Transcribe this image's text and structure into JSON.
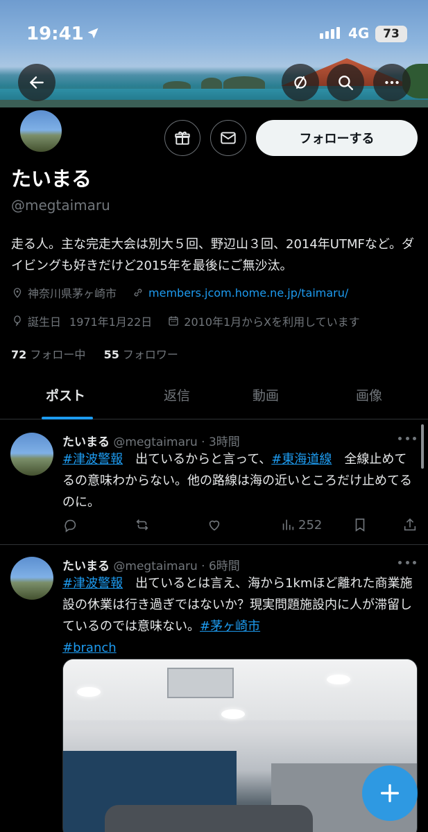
{
  "status_bar": {
    "time": "19:41",
    "network": "4G",
    "battery": "73"
  },
  "profile": {
    "display_name": "たいまる",
    "handle": "@megtaimaru",
    "follow_label": "フォローする",
    "bio": "走る人。主な完走大会は別大５回、野辺山３回、2014年UTMFなど。ダイビングも好きだけど2015年を最後にご無沙汰。",
    "location": "神奈川県茅ヶ崎市",
    "website": "members.jcom.home.ne.jp/taimaru/",
    "birthday_label": "誕生日",
    "birthday": "1971年1月22日",
    "joined": "2010年1月からXを利用しています",
    "following_count": "72",
    "following_label": "フォロー中",
    "followers_count": "55",
    "followers_label": "フォロワー"
  },
  "tabs": [
    "ポスト",
    "返信",
    "動画",
    "画像"
  ],
  "tweets": [
    {
      "name": "たいまる",
      "handle": "@megtaimaru",
      "sep": "·",
      "time": "3時間",
      "tag1": "#津波警報",
      "text1": "　出ているからと言って、",
      "tag2": "#東海道線",
      "text2": "　全線止めてるの意味わからない。他の路線は海の近いところだけ止めてるのに。",
      "views": "252"
    },
    {
      "name": "たいまる",
      "handle": "@megtaimaru",
      "sep": "·",
      "time": "6時間",
      "tag1": "#津波警報",
      "text1": "　出ているとは言え、海から1kmほど離れた商業施設の休業は行き過ぎではないか？現実問題施設内に人が滞留しているのでは意味ない。",
      "tag2": "#茅ヶ崎市",
      "tag3": "#branch"
    }
  ],
  "icons": {
    "back": "arrow-left-icon",
    "hide": "eye-slash-icon",
    "search": "search-icon",
    "more": "more-horizontal-icon",
    "gift": "gift-icon",
    "message": "envelope-icon",
    "location": "location-pin-icon",
    "link": "link-icon",
    "birthday": "balloon-icon",
    "calendar": "calendar-icon",
    "reply": "reply-icon",
    "repost": "repost-icon",
    "like": "heart-icon",
    "views": "views-chart-icon",
    "bookmark": "bookmark-icon",
    "share": "share-icon",
    "compose": "plus-icon"
  },
  "colors": {
    "accent": "#1d9bf0",
    "muted": "#71767b",
    "background": "#000000"
  }
}
